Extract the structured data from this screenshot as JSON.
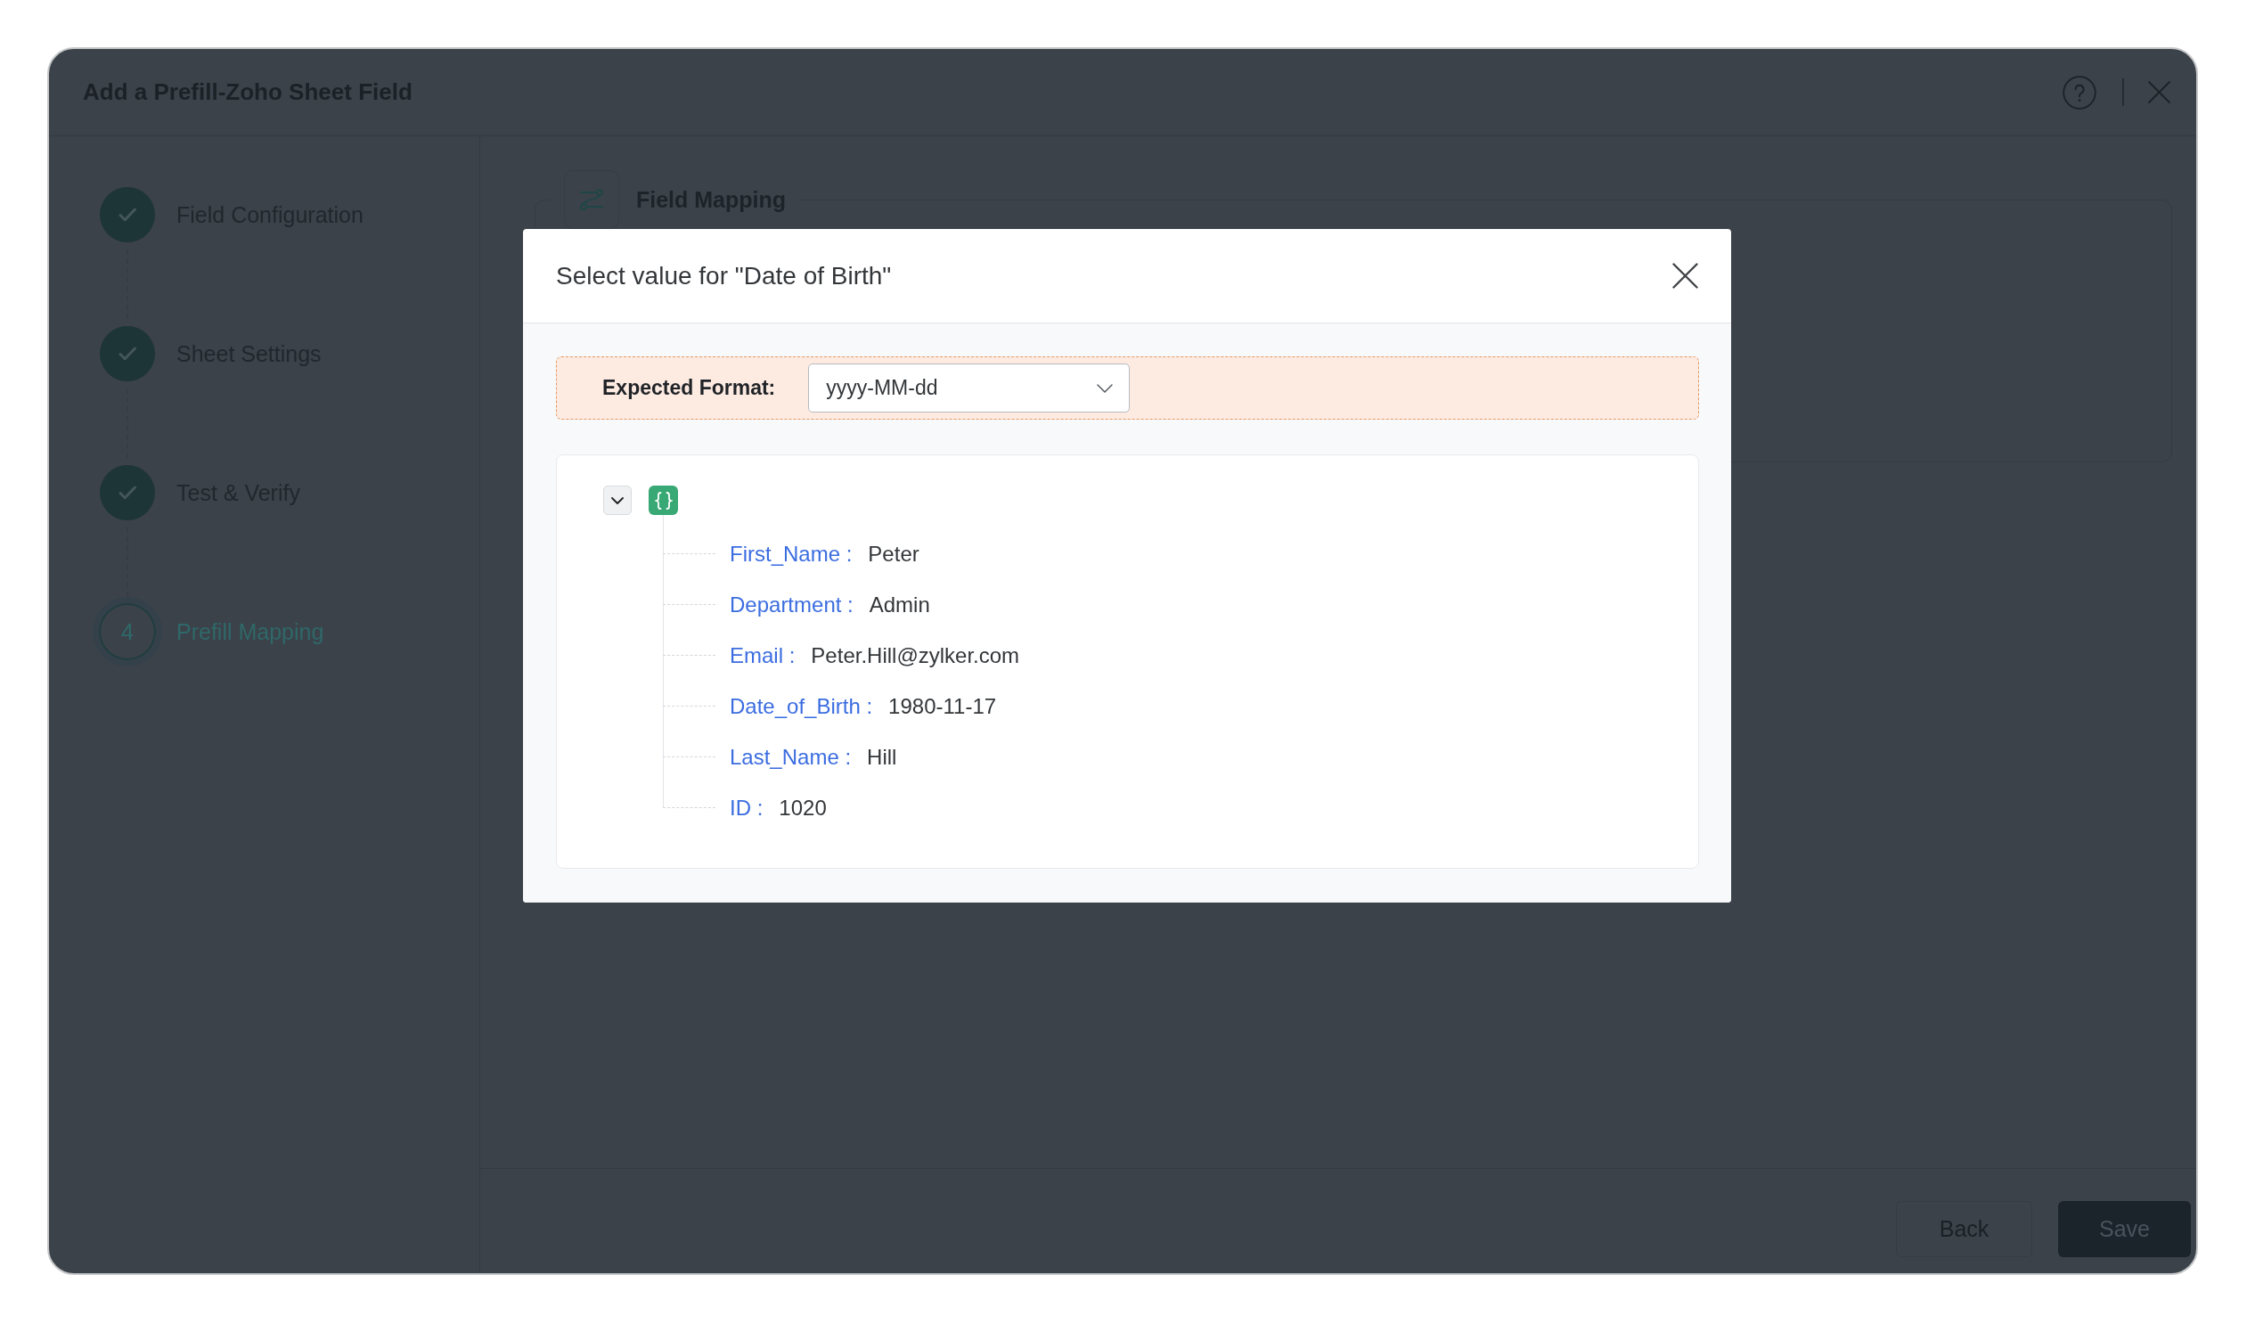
{
  "dialog": {
    "title": "Add a Prefill-Zoho Sheet Field"
  },
  "steps": [
    {
      "label": "Field Configuration",
      "completed": true,
      "selected": false
    },
    {
      "label": "Sheet Settings",
      "completed": true,
      "selected": false
    },
    {
      "label": "Test & Verify",
      "completed": true,
      "selected": false
    },
    {
      "label": "Prefill Mapping",
      "number": "4",
      "completed": false,
      "selected": true
    }
  ],
  "section": {
    "title": "Field Mapping"
  },
  "footer": {
    "buttons": [
      {
        "label": "Back",
        "kind": "secondary"
      },
      {
        "label": "Save",
        "kind": "primary"
      }
    ]
  },
  "modal": {
    "title": "Select value for \"Date of Birth\"",
    "format": {
      "label": "Expected Format:",
      "value": "yyyy-MM-dd"
    },
    "tree": {
      "expanded": true,
      "children": [
        {
          "key": "First_Name :",
          "value": "Peter"
        },
        {
          "key": "Department :",
          "value": "Admin"
        },
        {
          "key": "Email :",
          "value": "Peter.Hill@zylker.com"
        },
        {
          "key": "Date_of_Birth :",
          "value": "1980-11-17"
        },
        {
          "key": "Last_Name :",
          "value": "Hill"
        },
        {
          "key": "ID :",
          "value": "1020"
        }
      ]
    }
  }
}
